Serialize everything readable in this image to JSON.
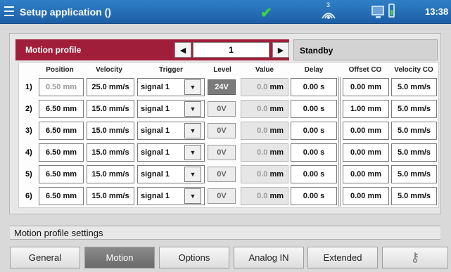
{
  "titlebar": {
    "title": "Setup application ()",
    "signal_num": "3",
    "time": "13:38"
  },
  "profile": {
    "title": "Motion profile",
    "prev_label": "◀",
    "next_label": "▶",
    "number": "1",
    "status": "Standby"
  },
  "headers": {
    "position": "Position",
    "velocity": "Velocity",
    "trigger": "Trigger",
    "level": "Level",
    "value": "Value",
    "delay": "Delay",
    "offset_co": "Offset CO",
    "velocity_co": "Velocity CO"
  },
  "rows": [
    {
      "label": "1)",
      "position": "0.50 mm",
      "velocity": "25.0 mm/s",
      "trigger": "signal 1",
      "level": "24V",
      "value_num": "0.0",
      "value_unit": "mm",
      "delay": "0.00   s",
      "offset": "0.00 mm",
      "velocity_co": "5.0 mm/s"
    },
    {
      "label": "2)",
      "position": "6.50 mm",
      "velocity": "15.0 mm/s",
      "trigger": "signal 1",
      "level": "0V",
      "value_num": "0.0",
      "value_unit": "mm",
      "delay": "0.00   s",
      "offset": "1.00 mm",
      "velocity_co": "5.0 mm/s"
    },
    {
      "label": "3)",
      "position": "6.50 mm",
      "velocity": "15.0 mm/s",
      "trigger": "signal 1",
      "level": "0V",
      "value_num": "0.0",
      "value_unit": "mm",
      "delay": "0.00   s",
      "offset": "0.00 mm",
      "velocity_co": "5.0 mm/s"
    },
    {
      "label": "4)",
      "position": "6.50 mm",
      "velocity": "15.0 mm/s",
      "trigger": "signal 1",
      "level": "0V",
      "value_num": "0.0",
      "value_unit": "mm",
      "delay": "0.00   s",
      "offset": "0.00 mm",
      "velocity_co": "5.0 mm/s"
    },
    {
      "label": "5)",
      "position": "6.50 mm",
      "velocity": "15.0 mm/s",
      "trigger": "signal 1",
      "level": "0V",
      "value_num": "0.0",
      "value_unit": "mm",
      "delay": "0.00   s",
      "offset": "0.00 mm",
      "velocity_co": "5.0 mm/s"
    },
    {
      "label": "6)",
      "position": "6.50 mm",
      "velocity": "15.0 mm/s",
      "trigger": "signal 1",
      "level": "0V",
      "value_num": "0.0",
      "value_unit": "mm",
      "delay": "0.00   s",
      "offset": "0.00 mm",
      "velocity_co": "5.0 mm/s"
    }
  ],
  "dropdown_glyph": "▼",
  "settings_label": "Motion profile settings",
  "tabs": [
    {
      "label": "General"
    },
    {
      "label": "Motion"
    },
    {
      "label": "Options"
    },
    {
      "label": "Analog IN"
    },
    {
      "label": "Extended"
    },
    {
      "label": "⚷"
    }
  ],
  "colors": {
    "titlebar": "#1c5fa6",
    "profile_bar": "#a11e3b",
    "active_tab": "#6a6a6a"
  }
}
